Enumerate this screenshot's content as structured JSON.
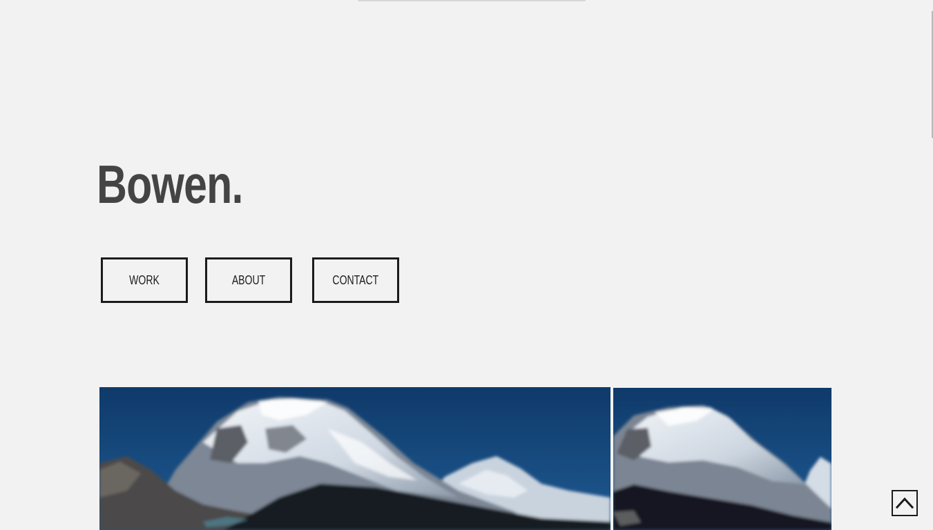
{
  "site": {
    "title": "Bowen."
  },
  "nav": {
    "items": [
      {
        "label": "WORK"
      },
      {
        "label": "ABOUT"
      },
      {
        "label": "CONTACT"
      }
    ]
  },
  "gallery": {
    "images": [
      {
        "subject": "snow-capped mountain photo"
      },
      {
        "subject": "snow-capped mountain photo"
      }
    ]
  },
  "icons": {
    "back_to_top": "chevron-up-icon"
  },
  "colors": {
    "background": "#f2f2f2",
    "title": "#444444",
    "button_border": "#1b1b1b",
    "sky": "#123f6e"
  }
}
